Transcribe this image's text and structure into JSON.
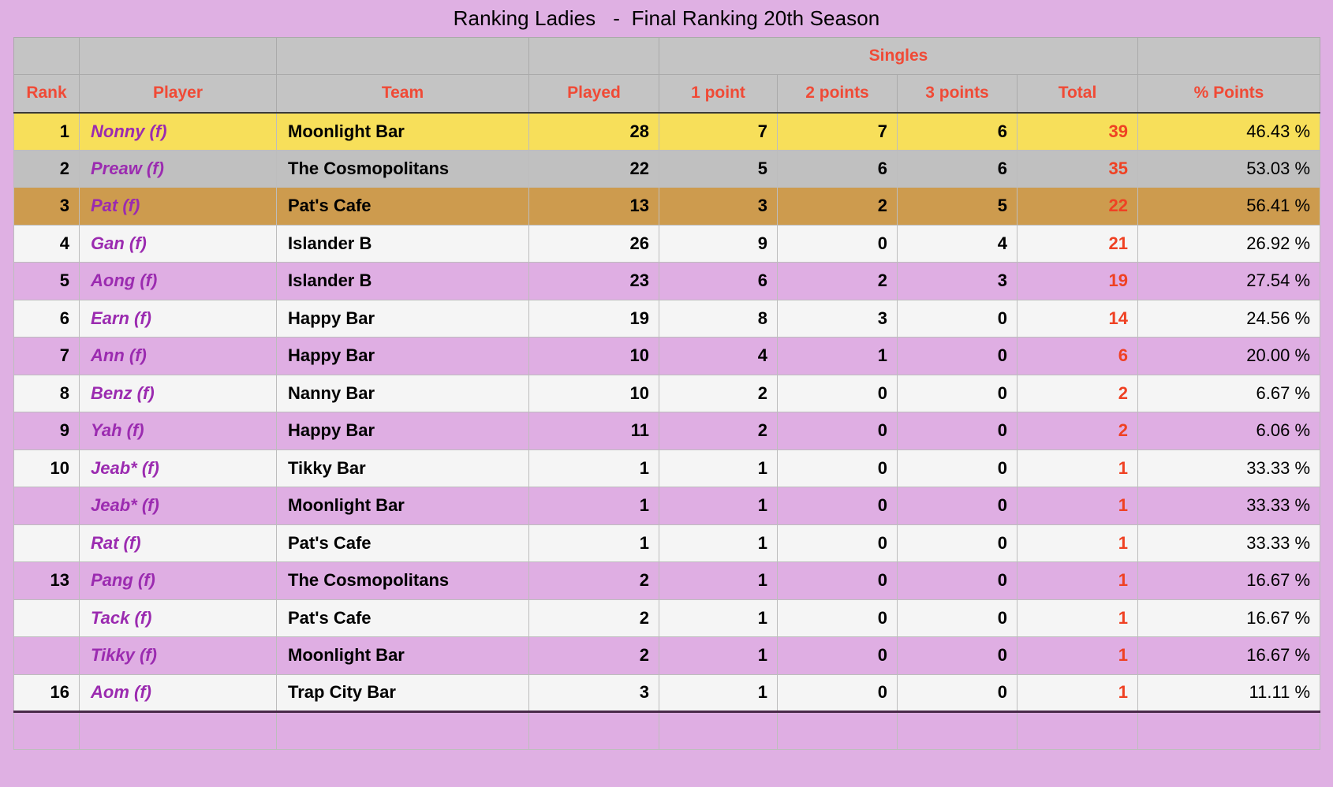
{
  "page": {
    "title": "Ranking Ladies   -  Final Ranking 20th Season",
    "background_color": "#dfb0e3",
    "accent_color": "#f04a36",
    "player_color": "#9b2bb0"
  },
  "table": {
    "group_header": {
      "singles": "Singles"
    },
    "columns": [
      {
        "key": "rank",
        "label": "Rank"
      },
      {
        "key": "player",
        "label": "Player"
      },
      {
        "key": "team",
        "label": "Team"
      },
      {
        "key": "played",
        "label": "Played"
      },
      {
        "key": "p1",
        "label": "1 point"
      },
      {
        "key": "p2",
        "label": "2 points"
      },
      {
        "key": "p3",
        "label": "3 points"
      },
      {
        "key": "total",
        "label": "Total"
      },
      {
        "key": "pct",
        "label": "% Points"
      }
    ],
    "rows": [
      {
        "rank": "1",
        "player": "Nonny (f)",
        "team": "Moonlight Bar",
        "played": "28",
        "p1": "7",
        "p2": "7",
        "p3": "6",
        "total": "39",
        "pct": "46.43 %",
        "style": "rank-gold"
      },
      {
        "rank": "2",
        "player": "Preaw (f)",
        "team": "The Cosmopolitans",
        "played": "22",
        "p1": "5",
        "p2": "6",
        "p3": "6",
        "total": "35",
        "pct": "53.03 %",
        "style": "rank-silver"
      },
      {
        "rank": "3",
        "player": "Pat (f)",
        "team": "Pat's Cafe",
        "played": "13",
        "p1": "3",
        "p2": "2",
        "p3": "5",
        "total": "22",
        "pct": "56.41 %",
        "style": "rank-bronze"
      },
      {
        "rank": "4",
        "player": "Gan (f)",
        "team": "Islander B",
        "played": "26",
        "p1": "9",
        "p2": "0",
        "p3": "4",
        "total": "21",
        "pct": "26.92 %",
        "style": "alt-light"
      },
      {
        "rank": "5",
        "player": "Aong (f)",
        "team": "Islander B",
        "played": "23",
        "p1": "6",
        "p2": "2",
        "p3": "3",
        "total": "19",
        "pct": "27.54 %",
        "style": "alt-pink"
      },
      {
        "rank": "6",
        "player": "Earn (f)",
        "team": "Happy Bar",
        "played": "19",
        "p1": "8",
        "p2": "3",
        "p3": "0",
        "total": "14",
        "pct": "24.56 %",
        "style": "alt-light"
      },
      {
        "rank": "7",
        "player": "Ann (f)",
        "team": "Happy Bar",
        "played": "10",
        "p1": "4",
        "p2": "1",
        "p3": "0",
        "total": "6",
        "pct": "20.00 %",
        "style": "alt-pink"
      },
      {
        "rank": "8",
        "player": "Benz (f)",
        "team": "Nanny Bar",
        "played": "10",
        "p1": "2",
        "p2": "0",
        "p3": "0",
        "total": "2",
        "pct": "6.67 %",
        "style": "alt-light"
      },
      {
        "rank": "9",
        "player": "Yah (f)",
        "team": "Happy Bar",
        "played": "11",
        "p1": "2",
        "p2": "0",
        "p3": "0",
        "total": "2",
        "pct": "6.06 %",
        "style": "alt-pink"
      },
      {
        "rank": "10",
        "player": "Jeab* (f)",
        "team": "Tikky Bar",
        "played": "1",
        "p1": "1",
        "p2": "0",
        "p3": "0",
        "total": "1",
        "pct": "33.33 %",
        "style": "alt-light"
      },
      {
        "rank": "",
        "player": "Jeab* (f)",
        "team": "Moonlight Bar",
        "played": "1",
        "p1": "1",
        "p2": "0",
        "p3": "0",
        "total": "1",
        "pct": "33.33 %",
        "style": "alt-pink"
      },
      {
        "rank": "",
        "player": "Rat (f)",
        "team": "Pat's Cafe",
        "played": "1",
        "p1": "1",
        "p2": "0",
        "p3": "0",
        "total": "1",
        "pct": "33.33 %",
        "style": "alt-light"
      },
      {
        "rank": "13",
        "player": "Pang (f)",
        "team": "The Cosmopolitans",
        "played": "2",
        "p1": "1",
        "p2": "0",
        "p3": "0",
        "total": "1",
        "pct": "16.67 %",
        "style": "alt-pink"
      },
      {
        "rank": "",
        "player": "Tack (f)",
        "team": "Pat's Cafe",
        "played": "2",
        "p1": "1",
        "p2": "0",
        "p3": "0",
        "total": "1",
        "pct": "16.67 %",
        "style": "alt-light"
      },
      {
        "rank": "",
        "player": "Tikky (f)",
        "team": "Moonlight Bar",
        "played": "2",
        "p1": "1",
        "p2": "0",
        "p3": "0",
        "total": "1",
        "pct": "16.67 %",
        "style": "alt-pink"
      },
      {
        "rank": "16",
        "player": "Aom (f)",
        "team": "Trap City Bar",
        "played": "3",
        "p1": "1",
        "p2": "0",
        "p3": "0",
        "total": "1",
        "pct": "11.11 %",
        "style": "alt-light"
      }
    ]
  }
}
